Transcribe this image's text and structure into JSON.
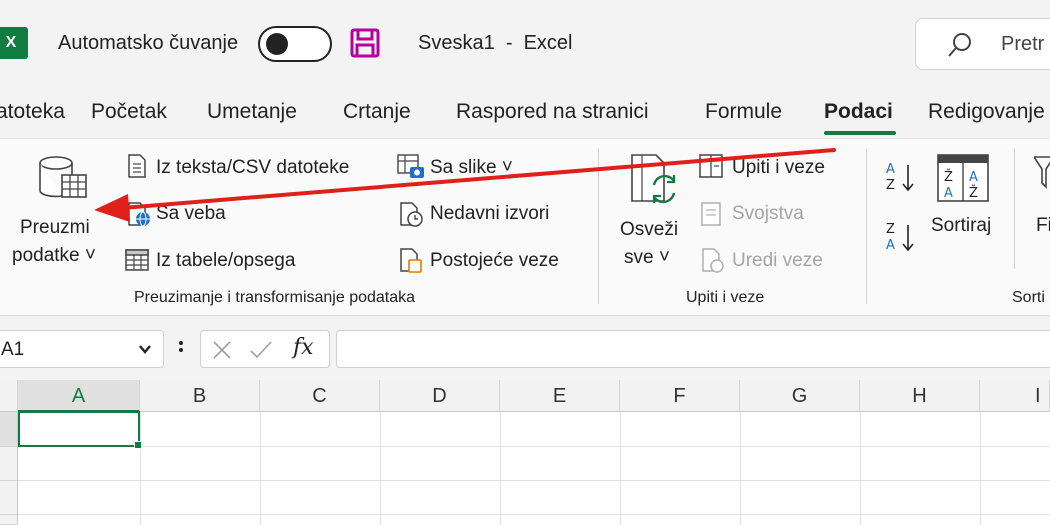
{
  "titlebar": {
    "app_icon_letter": "X",
    "autosave_label": "Automatsko čuvanje",
    "document_title": "Sveska1  -  Excel",
    "search_placeholder": "Pretr"
  },
  "tabs": [
    "atoteka",
    "Početak",
    "Umetanje",
    "Crtanje",
    "Raspored na stranici",
    "Formule",
    "Podaci",
    "Redigovanje"
  ],
  "active_tab": "Podaci",
  "ribbon": {
    "get_data": {
      "line1": "Preuzmi",
      "line2": "podatke ˅"
    },
    "from_text_csv": "Iz teksta/CSV datoteke",
    "from_web": "Sa veba",
    "from_table": "Iz tabele/opsega",
    "from_picture": "Sa slike ˅",
    "recent_sources": "Nedavni izvori",
    "existing_connections": "Postojeće veze",
    "group1_label": "Preuzimanje i transformisanje podataka",
    "refresh_all": {
      "line1": "Osveži",
      "line2": "sve ˅"
    },
    "queries_connections": "Upiti i veze",
    "properties": "Svojstva",
    "edit_links": "Uredi veze",
    "group2_label": "Upiti i veze",
    "sort_az_icon": "A↓Z",
    "sort_za_icon": "Z↓A",
    "sort": "Sortiraj",
    "filter_partial": "Fi",
    "group3_label": "Sorti"
  },
  "formula_bar": {
    "name_box": "A1",
    "fx": "fx",
    "formula": ""
  },
  "grid": {
    "columns": [
      "A",
      "B",
      "C",
      "D",
      "E",
      "F",
      "G",
      "H",
      "I"
    ],
    "selected_column": "A",
    "active_cell": "A1"
  },
  "colors": {
    "excel_green": "#107c41",
    "save_icon": "#b4009e",
    "arrow_red": "#e0201b"
  }
}
